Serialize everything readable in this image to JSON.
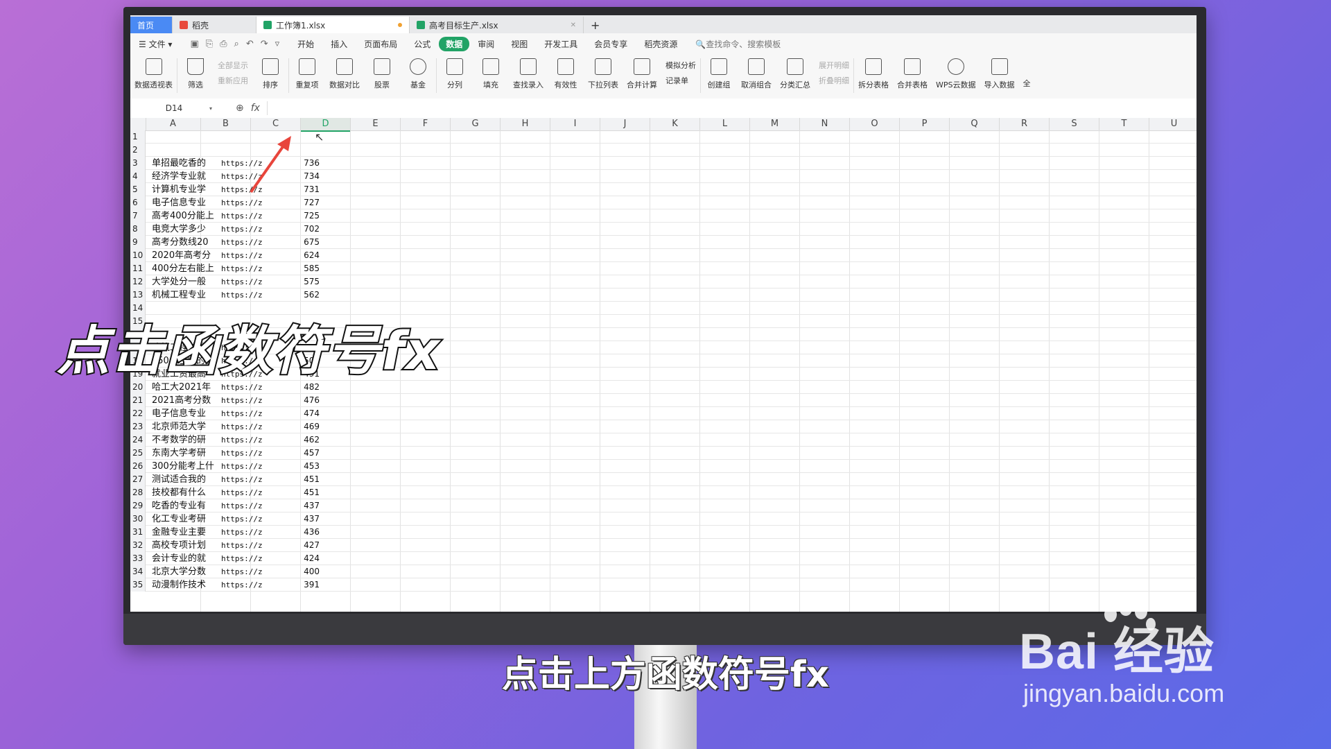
{
  "tabs": [
    {
      "label": "首页"
    },
    {
      "label": "稻壳"
    },
    {
      "label": "工作簿1.xlsx"
    },
    {
      "label": "高考目标生产.xlsx"
    }
  ],
  "menu": {
    "file": "文件",
    "items": [
      "开始",
      "插入",
      "页面布局",
      "公式",
      "数据",
      "审阅",
      "视图",
      "开发工具",
      "会员专享",
      "稻壳资源"
    ],
    "active": "数据",
    "search": "查找命令、搜索模板"
  },
  "ribbon": {
    "pivot": "数据透视表",
    "filter": "筛选",
    "show_all": "全部显示",
    "reapply": "重新应用",
    "sort": "排序",
    "dup": "重复项",
    "compare": "数据对比",
    "stock": "股票",
    "fund": "基金",
    "split": "分列",
    "fill": "填充",
    "lookup": "查找录入",
    "validity": "有效性",
    "dropdown": "下拉列表",
    "merge_calc": "合并计算",
    "simulate": "模拟分析",
    "record": "记录单",
    "create_group": "创建组",
    "ungroup": "取消组合",
    "subtotal": "分类汇总",
    "expand": "展开明细",
    "collapse": "折叠明细",
    "split_table": "拆分表格",
    "merge_table": "合并表格",
    "wps_cloud": "WPS云数据",
    "import": "导入数据",
    "more": "全"
  },
  "formula_bar": {
    "cell_ref": "D14",
    "fx": "fx"
  },
  "columns": [
    "A",
    "B",
    "C",
    "D",
    "E",
    "F",
    "G",
    "H",
    "I",
    "J",
    "K",
    "L",
    "M",
    "N",
    "O",
    "P",
    "Q",
    "R",
    "S",
    "T",
    "U"
  ],
  "selected_column": "D",
  "rows": [
    {
      "n": "1",
      "a": "",
      "b": "",
      "c": ""
    },
    {
      "n": "2",
      "a": "",
      "b": "",
      "c": ""
    },
    {
      "n": "3",
      "a": "单招最吃香的",
      "b": "https://z",
      "c": "736"
    },
    {
      "n": "4",
      "a": "经济学专业就",
      "b": "https://z",
      "c": "734"
    },
    {
      "n": "5",
      "a": "计算机专业学",
      "b": "https://z",
      "c": "731"
    },
    {
      "n": "6",
      "a": "电子信息专业",
      "b": "https://z",
      "c": "727"
    },
    {
      "n": "7",
      "a": "高考400分能上",
      "b": "https://z",
      "c": "725"
    },
    {
      "n": "8",
      "a": "电竞大学多少",
      "b": "https://z",
      "c": "702"
    },
    {
      "n": "9",
      "a": "高考分数线20",
      "b": "https://z",
      "c": "675"
    },
    {
      "n": "10",
      "a": "2020年高考分",
      "b": "https://z",
      "c": "624"
    },
    {
      "n": "11",
      "a": "400分左右能上",
      "b": "https://z",
      "c": "585"
    },
    {
      "n": "12",
      "a": "大学处分一般",
      "b": "https://z",
      "c": "575"
    },
    {
      "n": "13",
      "a": "机械工程专业",
      "b": "https://z",
      "c": "562"
    },
    {
      "n": "14",
      "a": "",
      "b": "",
      "c": ""
    },
    {
      "n": "15",
      "a": "",
      "b": "",
      "c": ""
    },
    {
      "n": "16",
      "a": "",
      "b": "",
      "c": ""
    },
    {
      "n": "17",
      "a": "建筑工程技术",
      "b": "https://z",
      "c": "510"
    },
    {
      "n": "18",
      "a": "550分左右的重",
      "b": "https://z",
      "c": "501"
    },
    {
      "n": "19",
      "a": "就业工资最高",
      "b": "https://z",
      "c": "491"
    },
    {
      "n": "20",
      "a": "哈工大2021年",
      "b": "https://z",
      "c": "482"
    },
    {
      "n": "21",
      "a": "2021高考分数",
      "b": "https://z",
      "c": "476"
    },
    {
      "n": "22",
      "a": "电子信息专业",
      "b": "https://z",
      "c": "474"
    },
    {
      "n": "23",
      "a": "北京师范大学",
      "b": "https://z",
      "c": "469"
    },
    {
      "n": "24",
      "a": "不考数学的研",
      "b": "https://z",
      "c": "462"
    },
    {
      "n": "25",
      "a": "东南大学考研",
      "b": "https://z",
      "c": "457"
    },
    {
      "n": "26",
      "a": "300分能考上什",
      "b": "https://z",
      "c": "453"
    },
    {
      "n": "27",
      "a": "测试适合我的",
      "b": "https://z",
      "c": "451"
    },
    {
      "n": "28",
      "a": "技校都有什么",
      "b": "https://z",
      "c": "451"
    },
    {
      "n": "29",
      "a": "吃香的专业有",
      "b": "https://z",
      "c": "437"
    },
    {
      "n": "30",
      "a": "化工专业考研",
      "b": "https://z",
      "c": "437"
    },
    {
      "n": "31",
      "a": "金融专业主要",
      "b": "https://z",
      "c": "436"
    },
    {
      "n": "32",
      "a": "高校专项计划",
      "b": "https://z",
      "c": "427"
    },
    {
      "n": "33",
      "a": "会计专业的就",
      "b": "https://z",
      "c": "424"
    },
    {
      "n": "34",
      "a": "北京大学分数",
      "b": "https://z",
      "c": "400"
    },
    {
      "n": "35",
      "a": "动漫制作技术",
      "b": "https://z",
      "c": "391"
    }
  ],
  "overlay": {
    "caption": "点击函数符号fx",
    "subtitle": "点击上方函数符号fx"
  },
  "watermark": {
    "main": "Bai 经验",
    "sub": "jingyan.baidu.com"
  },
  "colors": {
    "accent": "#21a366",
    "arrow": "#e8453c",
    "home_tab": "#4a8af4"
  }
}
